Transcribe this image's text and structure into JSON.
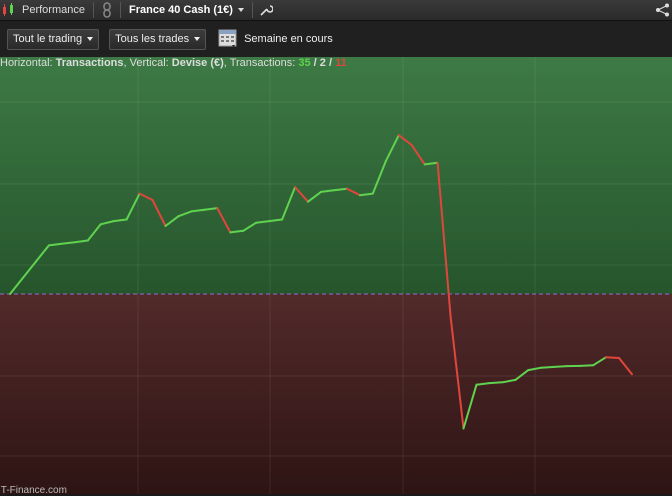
{
  "header": {
    "performance_label": "Performance",
    "instrument_label": "France 40 Cash (1€)",
    "icons": [
      "candlestick-icon",
      "link-icon",
      "wrench-icon",
      "share-icon"
    ]
  },
  "toolbar": {
    "trading_filter": "Tout le trading",
    "trades_filter": "Tous les trades",
    "period_label": "Semaine en cours"
  },
  "info": {
    "horizontal_label": "Horizontal: ",
    "horizontal_value": "Transactions",
    "vertical_label": ", Vertical: ",
    "vertical_value": "Devise (€)",
    "transactions_label": ", Transactions: ",
    "count_green": "35",
    "sep1": " / ",
    "count_white": "2",
    "sep2": " / ",
    "count_red": "11"
  },
  "watermark": "IT-Finance.com",
  "colors": {
    "gain": "#5fd34f",
    "loss": "#e0463c",
    "zero_line": "#8d6fd6",
    "positive_zone": "#2f6a37",
    "negative_zone": "#4a2424"
  },
  "chart_data": {
    "type": "line",
    "x": [
      0,
      1,
      2,
      3,
      4,
      5,
      6,
      7,
      8,
      9,
      10,
      11,
      12,
      13,
      14,
      15,
      16,
      17,
      18,
      19,
      20,
      21,
      22,
      23,
      24,
      25,
      26,
      27,
      28,
      29,
      30,
      31,
      32,
      33,
      34,
      35,
      36,
      37,
      38,
      39,
      40,
      41,
      42,
      43,
      44,
      45,
      46,
      47,
      48
    ],
    "values": [
      0,
      1,
      2,
      3,
      3.1,
      3.2,
      3.3,
      4.3,
      4.5,
      4.6,
      6.2,
      5.8,
      4.2,
      4.8,
      5.1,
      5.2,
      5.3,
      3.8,
      3.9,
      4.4,
      4.5,
      4.6,
      6.6,
      5.7,
      6.3,
      6.4,
      6.5,
      6.1,
      6.2,
      8.2,
      9.8,
      9.2,
      8.0,
      8.1,
      -1.4,
      -8.3,
      -5.6,
      -5.5,
      -5.45,
      -5.3,
      -4.7,
      -4.55,
      -4.5,
      -4.45,
      -4.44,
      -4.4,
      -3.9,
      -3.95,
      -4.95
    ],
    "colors_by_segment": "green when rising, red when falling",
    "ylim": [
      -10,
      10
    ],
    "grid": true
  }
}
